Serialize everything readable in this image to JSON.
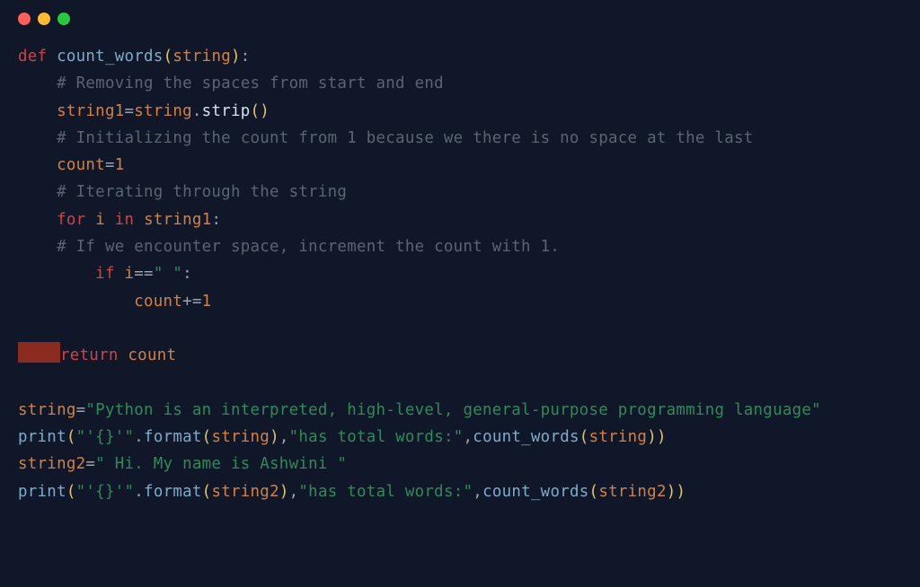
{
  "code": {
    "line1_def": "def",
    "line1_fn": "count_words",
    "line1_param": "string",
    "comment1": "# Removing the spaces from start and end",
    "line3_var": "string1",
    "line3_eq": "=",
    "line3_obj": "string",
    "line3_dot": ".",
    "line3_method": "strip",
    "comment2": "# Initializing the count from 1 because we there is no space at the last",
    "line5_var": "count",
    "line5_eq": "=",
    "line5_val": "1",
    "comment3": "# Iterating through the string",
    "line7_for": "for",
    "line7_i": "i",
    "line7_in": "in",
    "line7_obj": "string1",
    "comment4": "# If we encounter space, increment the count with 1.",
    "line9_if": "if",
    "line9_i": "i",
    "line9_eq": "==",
    "line9_str": "\" \"",
    "line10_var": "count",
    "line10_op": "+=",
    "line10_val": "1",
    "line12_ret": "return",
    "line12_var": "count",
    "line14_var": "string",
    "line14_eq": "=",
    "line14_str": "\"Python is an interpreted, high-level, general-purpose programming language\"",
    "line15_print": "print",
    "line15_str1": "\"'{}'\"",
    "line15_dot": ".",
    "line15_fmt": "format",
    "line15_arg1": "string",
    "line15_str2": "\"has total words:\"",
    "line15_fn": "count_words",
    "line15_arg2": "string",
    "line16_var": "string2",
    "line16_eq": "=",
    "line16_str": "\" Hi. My name is Ashwini \"",
    "line17_print": "print",
    "line17_str1": "\"'{}'\"",
    "line17_dot": ".",
    "line17_fmt": "format",
    "line17_arg1": "string2",
    "line17_str2": "\"has total words:\"",
    "line17_fn": "count_words",
    "line17_arg2": "string2"
  }
}
